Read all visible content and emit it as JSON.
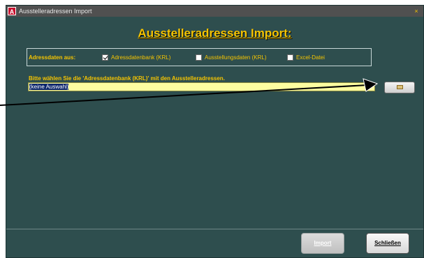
{
  "window": {
    "title": "Ausstelleradressen Import",
    "icon_letter": "A",
    "close_glyph": "×"
  },
  "heading": "Ausstelleradressen Import:",
  "source": {
    "label": "Adressdaten aus:",
    "options": [
      {
        "label": "Adressdatenbank (KRL)",
        "checked": true
      },
      {
        "label": "Ausstellungsdaten (KRL)",
        "checked": false
      },
      {
        "label": "Excel-Datei",
        "checked": false
      }
    ]
  },
  "hint": "Bitte wählen Sie die 'Adressdatenbank (KRL)' mit den Ausstelleradressen.",
  "path_field": {
    "value": "(keine Auswahl)"
  },
  "browse_button": {
    "icon": "folder-icon"
  },
  "buttons": {
    "import": "Import",
    "close": "Schließen"
  },
  "colors": {
    "background": "#2e4e4e",
    "accent_yellow": "#f5c400",
    "field_yellow": "#fdfda0"
  }
}
